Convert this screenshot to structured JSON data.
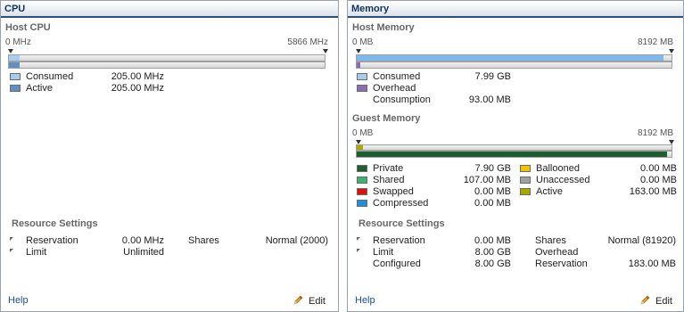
{
  "cpu": {
    "title": "CPU",
    "host_head": "Host CPU",
    "scale_min": "0 MHz",
    "scale_max": "5866 MHz",
    "consumed_fraction": 0.035,
    "active_fraction": 0.035,
    "legend": [
      {
        "label": "Consumed",
        "value": "205.00 MHz",
        "color": "#a8ccec"
      },
      {
        "label": "Active",
        "value": "205.00 MHz",
        "color": "#5f8fc4"
      }
    ],
    "resource_head": "Resource Settings",
    "reservation_label": "Reservation",
    "reservation_value": "0.00 MHz",
    "shares_label": "Shares",
    "shares_value": "Normal (2000)",
    "limit_label": "Limit",
    "limit_value": "Unlimited",
    "help": "Help",
    "edit": "Edit"
  },
  "memory": {
    "title": "Memory",
    "host_head": "Host Memory",
    "host_scale_min": "0 MB",
    "host_scale_max": "8192 MB",
    "host_consumed_fraction": 0.975,
    "host_legend": [
      {
        "label": "Consumed",
        "value": "7.99 GB",
        "color": "#a8ccec"
      },
      {
        "label": "Overhead",
        "value": "",
        "color": "#8c6db0"
      },
      {
        "label": "Consumption",
        "value": "93.00 MB",
        "color": ""
      }
    ],
    "guest_head": "Guest Memory",
    "guest_scale_min": "0 MB",
    "guest_scale_max": "8192 MB",
    "guest_private_fraction": 0.987,
    "guest_active_fraction": 0.02,
    "guest_legend_left": [
      {
        "label": "Private",
        "value": "7.90 GB",
        "color": "#1f5e2e"
      },
      {
        "label": "Shared",
        "value": "107.00 MB",
        "color": "#3cb371"
      },
      {
        "label": "Swapped",
        "value": "0.00 MB",
        "color": "#e01010"
      },
      {
        "label": "Compressed",
        "value": "0.00 MB",
        "color": "#1e90e0"
      }
    ],
    "guest_legend_right": [
      {
        "label": "Ballooned",
        "value": "0.00 MB",
        "color": "#f2c400"
      },
      {
        "label": "Unaccessed",
        "value": "0.00 MB",
        "color": "#a0a0a0"
      },
      {
        "label": "Active",
        "value": "163.00 MB",
        "color": "#a8a800"
      }
    ],
    "resource_head": "Resource Settings",
    "reservation_label": "Reservation",
    "reservation_value": "0.00 MB",
    "shares_label": "Shares",
    "shares_value": "Normal (81920)",
    "limit_label": "Limit",
    "limit_value": "8.00 GB",
    "overhead_label": "Overhead",
    "configured_label": "Configured",
    "configured_value": "8.00 GB",
    "reservation2_label": "Reservation",
    "reservation2_value": "183.00 MB",
    "help": "Help",
    "edit": "Edit"
  }
}
